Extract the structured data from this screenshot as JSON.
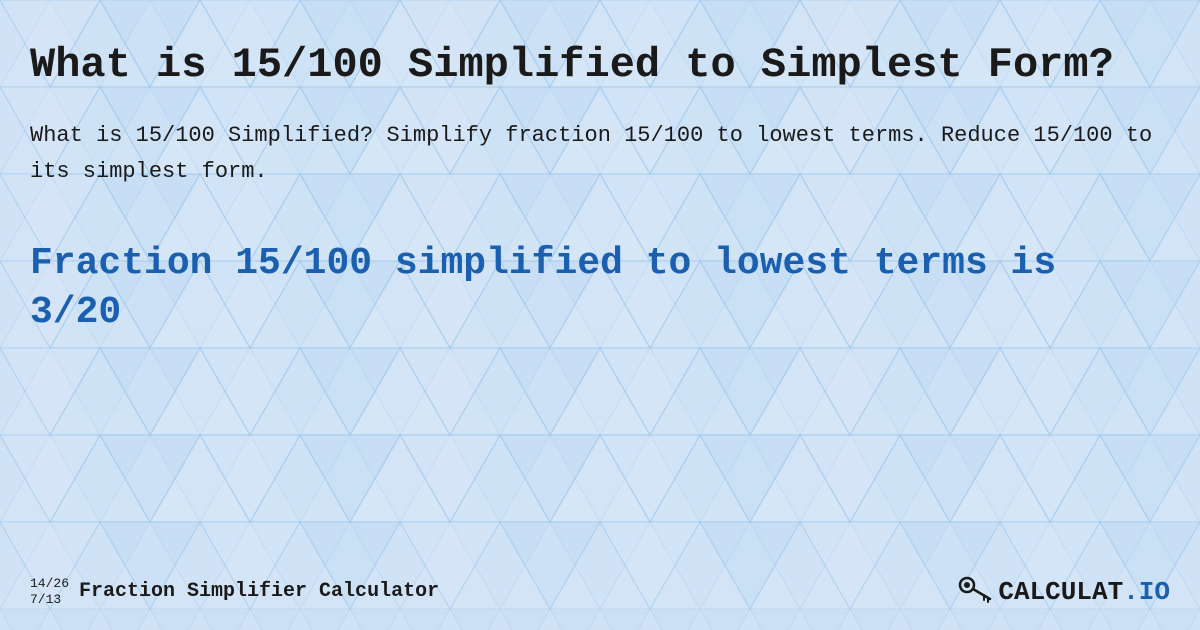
{
  "page": {
    "background_color": "#c8dff5",
    "main_title": "What is 15/100 Simplified to Simplest Form?",
    "description": "What is 15/100 Simplified? Simplify fraction 15/100 to lowest terms. Reduce 15/100 to its simplest form.",
    "result_text": "Fraction 15/100 simplified to lowest terms is 3/20",
    "footer": {
      "fraction_top": "14/26",
      "fraction_bottom": "7/13",
      "brand_label": "Fraction Simplifier Calculator",
      "logo_text_main": "CALCULAT",
      "logo_text_suffix": ".IO"
    }
  }
}
